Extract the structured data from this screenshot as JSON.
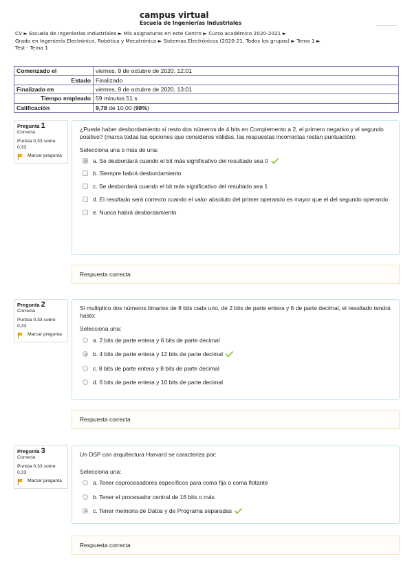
{
  "header": {
    "title": "campus virtual",
    "subtitle": "Escuela de Ingenierías Industriales"
  },
  "breadcrumb": {
    "line1": [
      "CV",
      "Escuela de Ingenierías Industriales",
      "Mis asignaturas en este Centro",
      "Curso académico 2020-2021"
    ],
    "line2": [
      "Grado en Ingeniería Electrónica, Robótica y Mecatrónica",
      "Sistemas Electrónicos (2020-21, Todos los grupos)",
      "Tema 1"
    ],
    "line3": "Test - Tema 1",
    "separator": "►"
  },
  "summary": {
    "started_label": "Comenzado el",
    "started_value": "viernes, 9 de octubre de 2020, 12:01",
    "state_label": "Estado",
    "state_value": "Finalizado",
    "finished_label": "Finalizado en",
    "finished_value": "viernes, 9 de octubre de 2020, 13:01",
    "time_label": "Tiempo empleado",
    "time_value": "59 minutos 51 s",
    "grade_label": "Calificación",
    "grade_score": "9,78",
    "grade_mid": " de 10,00 (",
    "grade_pct": "98%",
    "grade_end": ")"
  },
  "questions": [
    {
      "label": "Pregunta",
      "number": "1",
      "status": "Correcta",
      "points": "Puntúa 0,33 sobre 0,33",
      "flag_label": "Marcar pregunta",
      "prompt": "¿Puede haber desbordamiento si resto dos números de 4 bits en Complemento a 2, el primero negativo y el segundo positivo? (marca todas las opciones que consideres válidas, las respuestas incorrectas restan puntuación):",
      "instruction": "Selecciona una o más de una:",
      "answers": [
        "a. Se desbordará cuando el bit más significativo del resultado sea 0",
        "b. Siempre habrá desbordamiento",
        "c. Se desbordará cuando el bit más significativo del resultado sea 1",
        "d. El resultado será correcto cuando el valor absoluto del primer operando es mayor que el del segundo operando",
        "e. Nunca habrá desbordamiento"
      ],
      "feedback": "Respuesta correcta"
    },
    {
      "label": "Pregunta",
      "number": "2",
      "status": "Correcta",
      "points": "Puntúa 0,33 sobre 0,33",
      "flag_label": "Marcar pregunta",
      "prompt": "Si multiplico dos números binarios de 8 bits cada uno, de 2 bits de parte entera y 6 de parte decimal, el resultado tendrá hasta:",
      "instruction": "Selecciona una:",
      "answers": [
        "a. 2 bits de parte entera y 6 bits de parte decimal",
        "b. 4 bits de parte entera y 12 bits de parte decimal",
        "c. 8 bits de parte entera y 8 bits de parte decimal",
        "d. 6 bits de parte entera y 10 bits de parte decimal"
      ],
      "feedback": "Respuesta correcta"
    },
    {
      "label": "Pregunta",
      "number": "3",
      "status": "Correcta",
      "points": "Puntúa 0,33 sobre 0,33",
      "flag_label": "Marcar pregunta",
      "prompt": "Un DSP con arquitectura Harvard se caracteriza por:",
      "instruction": "Selecciona una:",
      "answers": [
        "a. Tener coprocesadores específicos para coma fija o coma flotante",
        "b. Tener el procesador central de 16 bits o más",
        "c. Tener memoria de Datos y de Programa separadas"
      ],
      "feedback": "Respuesta correcta"
    }
  ],
  "colors": {
    "table_border": "#7a6fae",
    "content_border": "#bfe3ee",
    "feedback_border": "#f3e3c1",
    "tick": "#8cc63f",
    "flag": "#f0a30a"
  },
  "icons": {
    "flag": "flag-icon",
    "tick": "check-icon"
  }
}
